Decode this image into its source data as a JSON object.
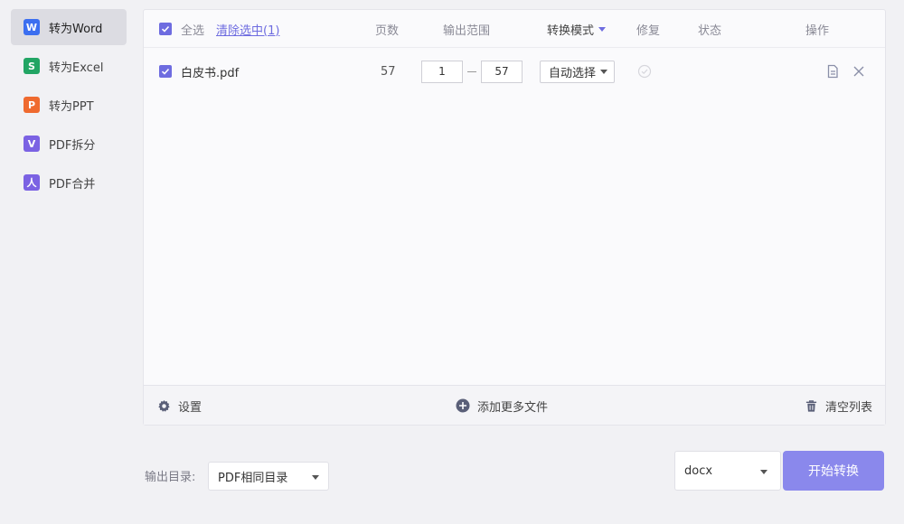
{
  "sidebar": {
    "items": [
      {
        "label": "转为Word",
        "icon_letter": "W",
        "color": "#3c6ff0"
      },
      {
        "label": "转为Excel",
        "icon_letter": "S",
        "color": "#22a564"
      },
      {
        "label": "转为PPT",
        "icon_letter": "P",
        "color": "#ef6a2f"
      },
      {
        "label": "PDF拆分",
        "icon_letter": "V",
        "color": "#7b62e3"
      },
      {
        "label": "PDF合并",
        "icon_letter": "人",
        "color": "#7b62e3"
      }
    ]
  },
  "table": {
    "select_all": "全选",
    "clear_selection": "清除选中(1)",
    "col_pages": "页数",
    "col_range": "输出范围",
    "col_mode": "转换模式",
    "col_repair": "修复",
    "col_status": "状态",
    "col_action": "操作",
    "rows": [
      {
        "filename": "白皮书.pdf",
        "pages": "57",
        "range_start": "1",
        "range_end": "57",
        "mode": "自动选择"
      }
    ]
  },
  "footer": {
    "settings": "设置",
    "add_files": "添加更多文件",
    "clear_list": "清空列表"
  },
  "output": {
    "label": "输出目录:",
    "dir": "PDF相同目录"
  },
  "format_select": "docx",
  "start_button": "开始转换",
  "colors": {
    "accent": "#6e6ce0",
    "button": "#8a88ec"
  }
}
